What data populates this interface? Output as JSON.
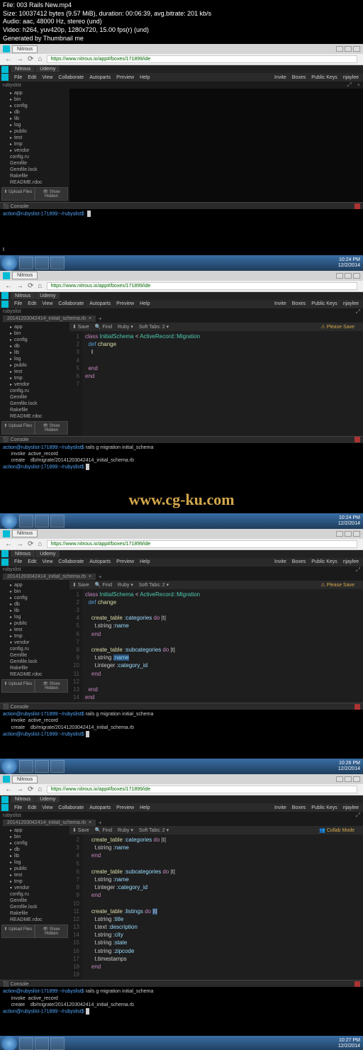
{
  "meta": {
    "file": "File: 003 Rails New.mp4",
    "size": "Size: 10037412 bytes (9.57 MiB), duration: 00:06:39, avg.bitrate: 201 kb/s",
    "audio": "Audio: aac, 48000 Hz, stereo (und)",
    "video": "Video: h264, yuv420p, 1280x720, 15.00 fps(r) (und)",
    "gen": "Generated by Thumbnail me"
  },
  "browser": {
    "tab": "Nitrous",
    "url": "https://www.nitrous.io/app#/boxes/171899/ide",
    "back": "←",
    "fwd": "→",
    "reload": "⟳",
    "home": "⌂"
  },
  "nitrous_tabs": {
    "t1": "Nitrous",
    "t2": "Udemy"
  },
  "ide_menu": {
    "file": "File",
    "edit": "Edit",
    "view": "View",
    "collab": "Collaborate",
    "autoparts": "Autoparts",
    "preview": "Preview",
    "help": "Help",
    "invite": "Invite",
    "boxes": "Boxes",
    "pubkeys": "Public Keys",
    "user": "njaylee"
  },
  "project": "rubyslist",
  "tree": {
    "app": "app",
    "bin": "bin",
    "config": "config",
    "db": "db",
    "lib": "lib",
    "log": "log",
    "public": "public",
    "test": "test",
    "tmp": "tmp",
    "vendor": "vendor",
    "configru": "config.ru",
    "gemfile": "Gemfile",
    "gemlock": "Gemfile.lock",
    "rakefile": "Rakefile",
    "readme": "README.rdoc"
  },
  "sidebar_btn": {
    "upload": "⬆ Upload Files",
    "hidden": "👁 Show Hidden"
  },
  "toolbar": {
    "save": "⬇ Save",
    "find": "🔍 Find",
    "lang": "Ruby ▾",
    "tabs": "Soft Tabs: 2 ▾",
    "please_save": "⚠ Please Save",
    "collab": "👥 Collab Mode"
  },
  "console_label": "⬛ Console",
  "editor_tab": "20141203042414_initial_schema.rb",
  "prompt1": "action@rubyslist-171899:~/rubyslist$",
  "code1": {
    "l1a": "class",
    "l1b": "InitialSchema",
    "l1c": "<",
    "l1d": "ActiveRecord::Migration",
    "l2a": "def",
    "l2b": "change",
    "l5": "end",
    "l6": "end"
  },
  "console2": {
    "l1a": "action@rubyslist-171899:~/rubyslist$",
    "l1b": "rails g migration initial_schema",
    "l2a": "invoke",
    "l2b": "active_record",
    "l3a": "create",
    "l3b": "db/migrate/20141203042414_initial_schema.rb"
  },
  "watermark": "www.cg-ku.com",
  "code3": {
    "l1a": "class",
    "l1b": "InitialSchema",
    "l1c": "<",
    "l1d": "ActiveRecord::Migration",
    "l2a": "def",
    "l2b": "change",
    "l4a": "create_table",
    "l4b": ":categories",
    "l4c": "do",
    "l4d": "|t|",
    "l5a": "t.string",
    "l5b": ":name",
    "l6": "end",
    "l8a": "create_table",
    "l8b": ":subcategories",
    "l8c": "do",
    "l8d": "|t|",
    "l9a": "t.string",
    "l9b": ":name",
    "l10a": "t.integer",
    "l10b": ":category_id",
    "l11": "end",
    "l13": "end",
    "l14": "end"
  },
  "code4": {
    "l2a": "create_table",
    "l2b": ":categories",
    "l2c": "do",
    "l2d": "|t|",
    "l3a": "t.string",
    "l3b": ":name",
    "l4": "end",
    "l6a": "create_table",
    "l6b": ":subcategories",
    "l6c": "do",
    "l6d": "|t|",
    "l7a": "t.string",
    "l7b": ":name",
    "l8a": "t.integer",
    "l8b": ":category_id",
    "l9": "end",
    "l11a": "create_table",
    "l11b": ":listings",
    "l11c": "do",
    "l11d": "|t|",
    "l12a": "t.string",
    "l12b": ":title",
    "l13a": "t.text",
    "l13b": ":description",
    "l14a": "t.string",
    "l14b": ":city",
    "l15a": "t.string",
    "l15b": ":state",
    "l16a": "t.string",
    "l16b": ":zipcode",
    "l17": "t.timestamps",
    "l18": "end"
  },
  "systray": {
    "time": "10:24 PM",
    "date": "12/2/2014"
  },
  "systray2": {
    "time": "10:24 PM",
    "date": "12/2/2014"
  },
  "systray3": {
    "time": "10:26 PM",
    "date": "12/2/2014"
  },
  "systray4": {
    "time": "10:27 PM",
    "date": "12/2/2014"
  }
}
